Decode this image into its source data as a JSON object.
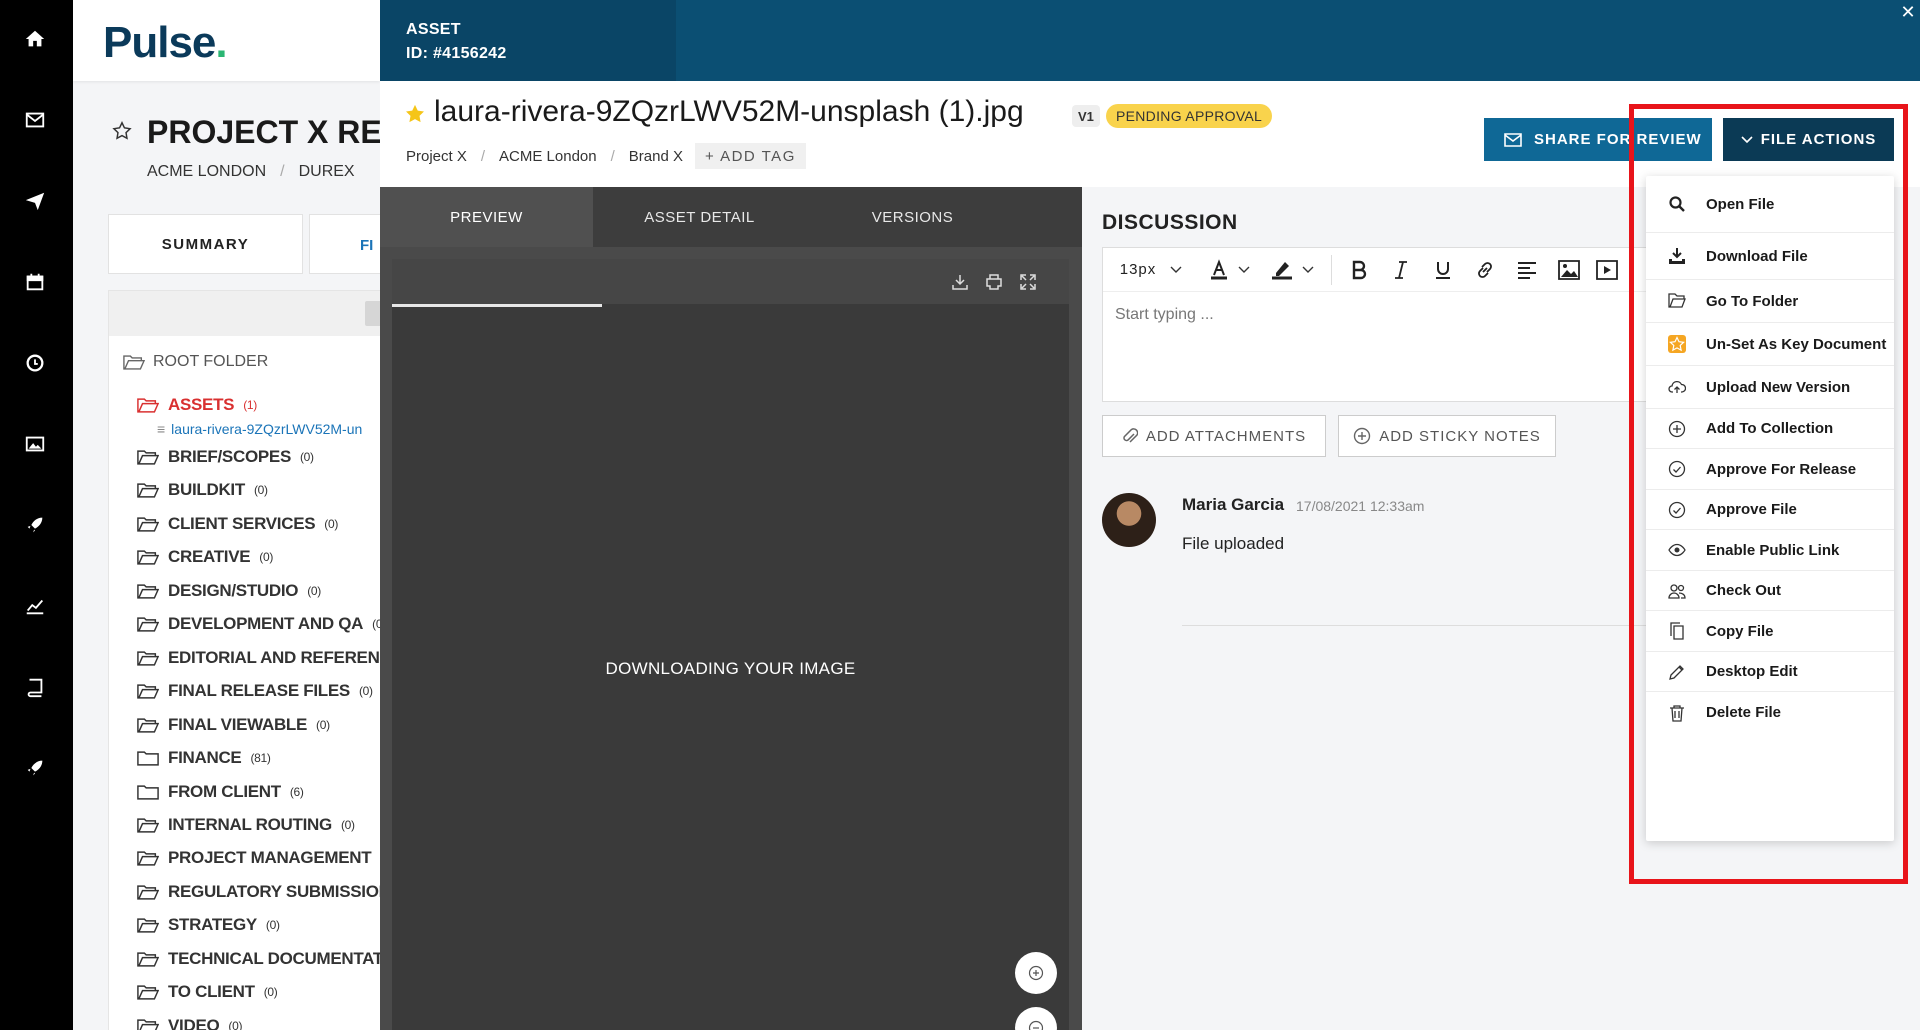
{
  "colors": {
    "rail": "#000000",
    "modal_header": "#0b4f73",
    "primary_button": "#0f6896",
    "file_actions_button": "#0b3a55",
    "status_badge": "#f9d34c",
    "active_folder": "#d93030",
    "highlight_box": "#e8141a"
  },
  "rail": {
    "icons": [
      "home-icon",
      "mail-icon",
      "send-icon",
      "calendar-icon",
      "clock-icon",
      "image-icon",
      "rocket-icon",
      "chart-icon",
      "book-icon",
      "rocket-icon-2"
    ]
  },
  "background_page": {
    "logo": "Pulse",
    "project_title": "PROJECT X RELA",
    "breadcrumbs": [
      "ACME LONDON",
      "DUREX"
    ],
    "tabs": {
      "summary": "SUMMARY",
      "files": "FI"
    },
    "tree": {
      "root": "ROOT FOLDER",
      "file": "laura-rivera-9ZQzrLWV52M-un",
      "folders": [
        {
          "name": "ASSETS",
          "count": "(1)"
        },
        {
          "name": "BRIEF/SCOPES",
          "count": "(0)"
        },
        {
          "name": "BUILDKIT",
          "count": "(0)"
        },
        {
          "name": "CLIENT SERVICES",
          "count": "(0)"
        },
        {
          "name": "CREATIVE",
          "count": "(0)"
        },
        {
          "name": "DESIGN/STUDIO",
          "count": "(0)"
        },
        {
          "name": "DEVELOPMENT AND QA",
          "count": "(0"
        },
        {
          "name": "EDITORIAL AND REFERENC",
          "count": ""
        },
        {
          "name": "FINAL RELEASE FILES",
          "count": "(0)"
        },
        {
          "name": "FINAL VIEWABLE",
          "count": "(0)"
        },
        {
          "name": "FINANCE",
          "count": "(81)"
        },
        {
          "name": "FROM CLIENT",
          "count": "(6)"
        },
        {
          "name": "INTERNAL ROUTING",
          "count": "(0)"
        },
        {
          "name": "PROJECT MANAGEMENT",
          "count": "("
        },
        {
          "name": "REGULATORY SUBMISSION",
          "count": ""
        },
        {
          "name": "STRATEGY",
          "count": "(0)"
        },
        {
          "name": "TECHNICAL DOCUMENTAT",
          "count": ""
        },
        {
          "name": "TO CLIENT",
          "count": "(0)"
        },
        {
          "name": "VIDEO",
          "count": "(0)"
        }
      ]
    }
  },
  "modal": {
    "asset_label": "ASSET",
    "asset_id": "ID: #4156242",
    "close": "✕",
    "title": "laura-rivera-9ZQzrLWV52M-unsplash (1).jpg",
    "version": "V1",
    "status": "PENDING APPROVAL",
    "breadcrumbs": [
      "Project X",
      "ACME London",
      "Brand X"
    ],
    "add_tag": "+ ADD TAG",
    "share_button": "SHARE FOR REVIEW",
    "file_actions_button": "FILE ACTIONS"
  },
  "preview": {
    "tabs": [
      "PREVIEW",
      "ASSET DETAIL",
      "VERSIONS"
    ],
    "message": "DOWNLOADING YOUR IMAGE"
  },
  "discussion": {
    "title": "DISCUSSION",
    "font_size": "13px",
    "placeholder": "Start typing ...",
    "attach_button": "ADD ATTACHMENTS",
    "sticky_button": "ADD STICKY NOTES",
    "comment": {
      "author": "Maria Garcia",
      "time": "17/08/2021 12:33am",
      "text": "File uploaded"
    }
  },
  "file_actions": [
    {
      "label": "Open File",
      "icon": "search-icon"
    },
    {
      "label": "Download File",
      "icon": "download-icon"
    },
    {
      "label": "Go To Folder",
      "icon": "folder-open-icon"
    },
    {
      "label": "Un-Set As Key Document",
      "icon": "star-icon"
    },
    {
      "label": "Upload New Version",
      "icon": "cloud-upload-icon"
    },
    {
      "label": "Add To Collection",
      "icon": "plus-circle-icon"
    },
    {
      "label": "Approve For Release",
      "icon": "check-circle-icon"
    },
    {
      "label": "Approve File",
      "icon": "check-circle-icon"
    },
    {
      "label": "Enable Public Link",
      "icon": "eye-icon"
    },
    {
      "label": "Check Out",
      "icon": "users-icon"
    },
    {
      "label": "Copy File",
      "icon": "copy-icon"
    },
    {
      "label": "Desktop Edit",
      "icon": "pencil-icon"
    },
    {
      "label": "Delete File",
      "icon": "trash-icon"
    }
  ]
}
